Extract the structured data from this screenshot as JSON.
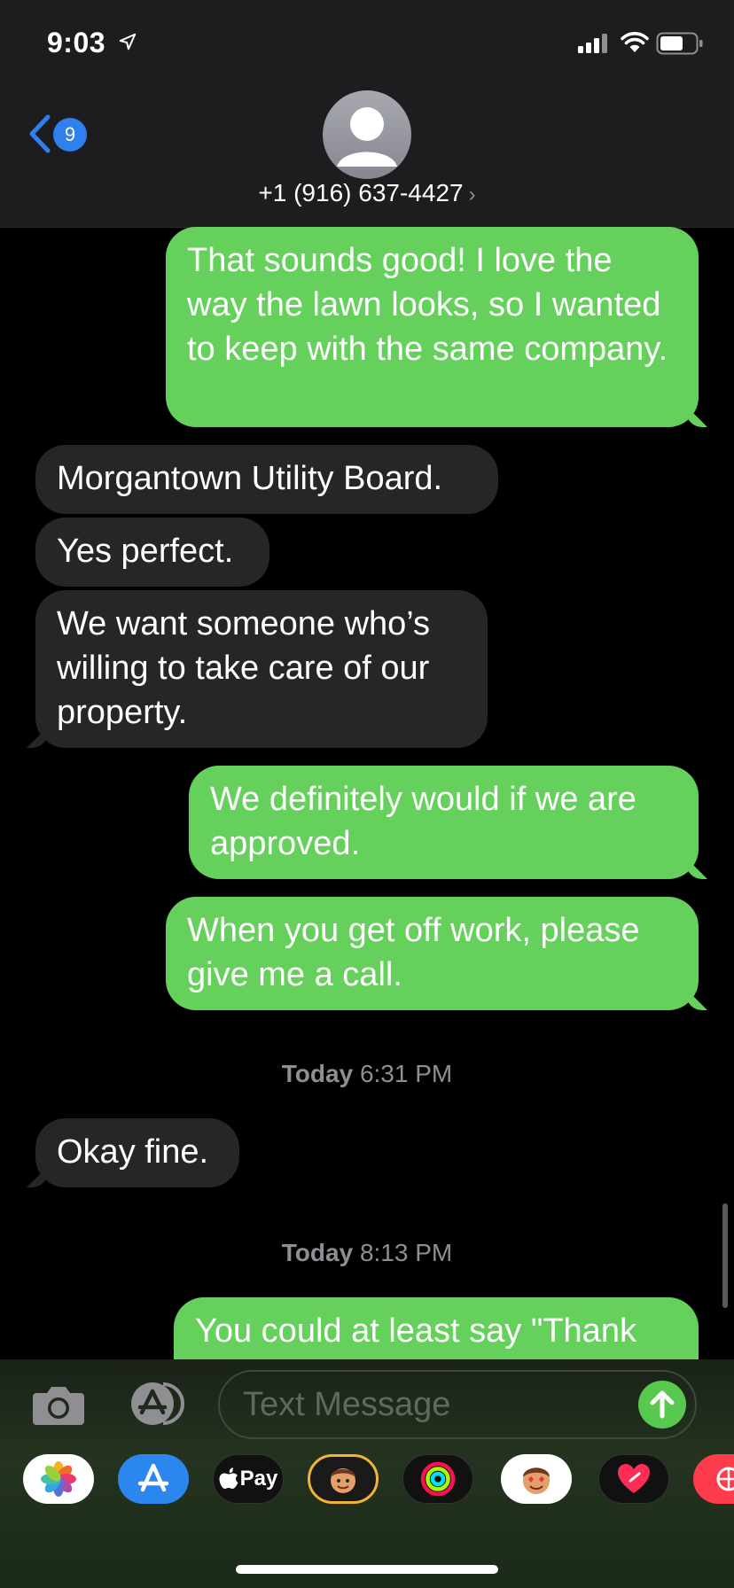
{
  "status_bar": {
    "time": "9:03"
  },
  "header": {
    "back_count": "9",
    "contact": "+1 (916) 637-4427"
  },
  "messages": [
    {
      "direction": "sent",
      "text": "That sounds good! I love the way the lawn looks, so I wanted to keep with the same company."
    },
    {
      "direction": "received",
      "text": "Morgantown Utility Board."
    },
    {
      "direction": "received",
      "text": "Yes perfect."
    },
    {
      "direction": "received",
      "text": "We want someone who’s willing to take care of our property."
    },
    {
      "direction": "sent",
      "text": "We definitely would if we are approved."
    },
    {
      "direction": "sent",
      "text": "When you get off work, please give me a call."
    },
    {
      "direction": "received",
      "text": "Okay fine."
    },
    {
      "direction": "sent",
      "text": "You could at least say \"Thank"
    }
  ],
  "timestamps": [
    {
      "day": "Today",
      "time": "6:31 PM"
    },
    {
      "day": "Today",
      "time": "8:13 PM"
    }
  ],
  "composer": {
    "placeholder": "Text Message"
  },
  "app_tray": [
    {
      "name": "photos",
      "color": "#ffffff"
    },
    {
      "name": "app-store",
      "color": "#2b87ee"
    },
    {
      "name": "apple-pay",
      "label": "Pay",
      "color": "#111111"
    },
    {
      "name": "memoji",
      "color": "#f2b437"
    },
    {
      "name": "activity",
      "color": "#111111"
    },
    {
      "name": "memoji-stickers",
      "color": "#ffffff"
    },
    {
      "name": "digital-touch",
      "color": "#111111"
    },
    {
      "name": "images-search",
      "color": "#ff3b4e"
    }
  ],
  "colors": {
    "sent_bubble": "#65d15c",
    "received_bubble": "#262628",
    "accent_blue": "#2f7fed"
  }
}
